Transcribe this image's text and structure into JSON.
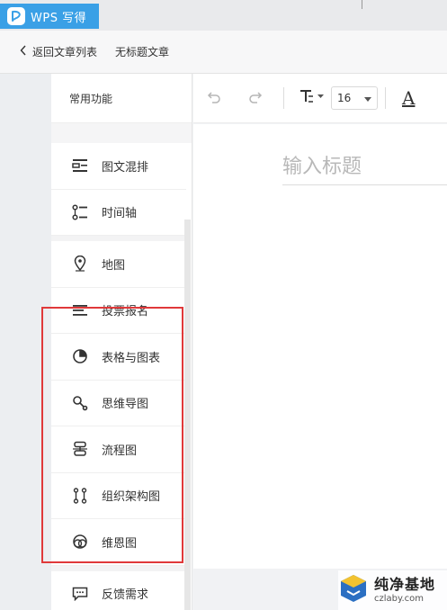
{
  "app": {
    "title": "WPS 写得"
  },
  "breadcrumb": {
    "back_label": "返回文章列表",
    "doc_name": "无标题文章"
  },
  "panel": {
    "heading": "常用功能",
    "items": [
      {
        "label": "图文混排",
        "icon": "image-text-layout-icon"
      },
      {
        "label": "时间轴",
        "icon": "timeline-icon"
      },
      {
        "label": "地图",
        "icon": "map-pin-icon"
      },
      {
        "label": "投票报名",
        "icon": "vote-list-icon"
      },
      {
        "label": "表格与图表",
        "icon": "pie-chart-icon"
      },
      {
        "label": "思维导图",
        "icon": "mind-map-icon"
      },
      {
        "label": "流程图",
        "icon": "flowchart-icon"
      },
      {
        "label": "组织架构图",
        "icon": "org-chart-icon"
      },
      {
        "label": "维恩图",
        "icon": "venn-diagram-icon"
      },
      {
        "label": "反馈需求",
        "icon": "feedback-icon"
      }
    ]
  },
  "toolbar": {
    "font_size": "16",
    "letter": "A"
  },
  "editor": {
    "title_placeholder": "输入标题"
  },
  "watermark": {
    "main": "纯净基地",
    "sub": "czlaby.com"
  },
  "colors": {
    "accent": "#3aa0e6",
    "highlight": "#e0393a"
  }
}
